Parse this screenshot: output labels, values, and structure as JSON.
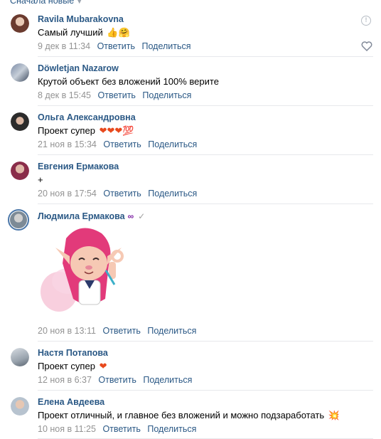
{
  "sort_label": "Сначала новые",
  "reply_label": "Ответить",
  "share_label": "Поделиться",
  "comments": [
    {
      "author": "Ravila Mubarakovna",
      "text": "Самый лучший",
      "emoji": "👍🤗",
      "date": "9 дек в 11:34"
    },
    {
      "author": "Döwletjan Nazarow",
      "text": "Крутой объект без вложений 100% верите",
      "emoji": "",
      "date": "8 дек в 15:45"
    },
    {
      "author": "Ольга Александровна",
      "text": "Проект супер",
      "emoji": "❤❤❤💯",
      "date": "21 ноя в 15:34"
    },
    {
      "author": "Евгения Ермакова",
      "text": "+",
      "emoji": "",
      "date": "20 ноя в 17:54"
    },
    {
      "author": "Людмила Ермакова",
      "text": "",
      "emoji": "",
      "date": "20 ноя в 13:11",
      "badge": "∞"
    },
    {
      "author": "Настя Потапова",
      "text": "Проект супер",
      "emoji": "❤",
      "date": "12 ноя в 6:37"
    },
    {
      "author": "Елена Авдеева",
      "text": "Проект отличный, и главное без вложений и можно подзаработать",
      "emoji": "💥",
      "date": "10 ноя в 11:25"
    }
  ],
  "colors": {
    "link": "#2a5885",
    "date": "#939393",
    "divider": "#e7e8ec",
    "heart": "#e8491d"
  },
  "icons": [
    "report-icon",
    "like-icon",
    "check-icon",
    "chevron-down-icon",
    "sticker-image"
  ]
}
